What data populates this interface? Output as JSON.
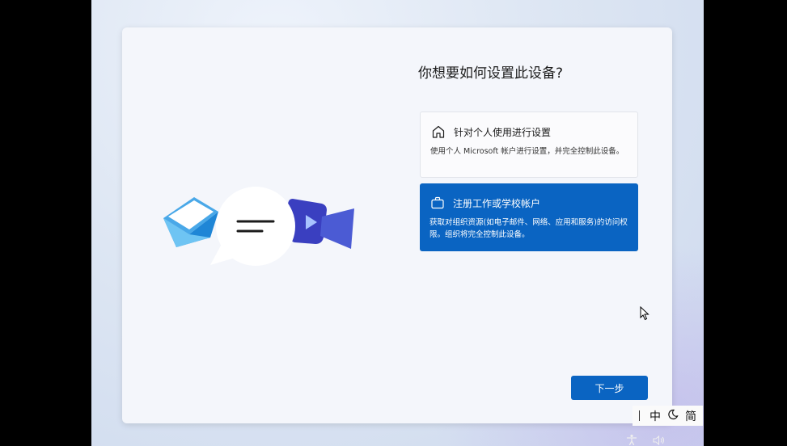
{
  "setup": {
    "title": "你想要如何设置此设备?",
    "options": [
      {
        "title": "针对个人使用进行设置",
        "description": "使用个人 Microsoft 帐户进行设置，并完全控制此设备。",
        "icon": "home-icon",
        "selected": false
      },
      {
        "title": "注册工作或学校帐户",
        "description": "获取对组织资源(如电子邮件、网络、应用和服务)的访问权限。组织将完全控制此设备。",
        "icon": "briefcase-icon",
        "selected": true
      }
    ],
    "next_label": "下一步"
  },
  "ime": {
    "mode": "中",
    "layout": "简"
  },
  "colors": {
    "accent": "#0a64c2",
    "card": "#f4f6fb",
    "background": "#dde6f3"
  },
  "icons": [
    "mail-icon",
    "chat-bubble-icon",
    "video-icon",
    "mouse-cursor-icon",
    "moon-icon",
    "accessibility-icon",
    "speaker-icon"
  ]
}
